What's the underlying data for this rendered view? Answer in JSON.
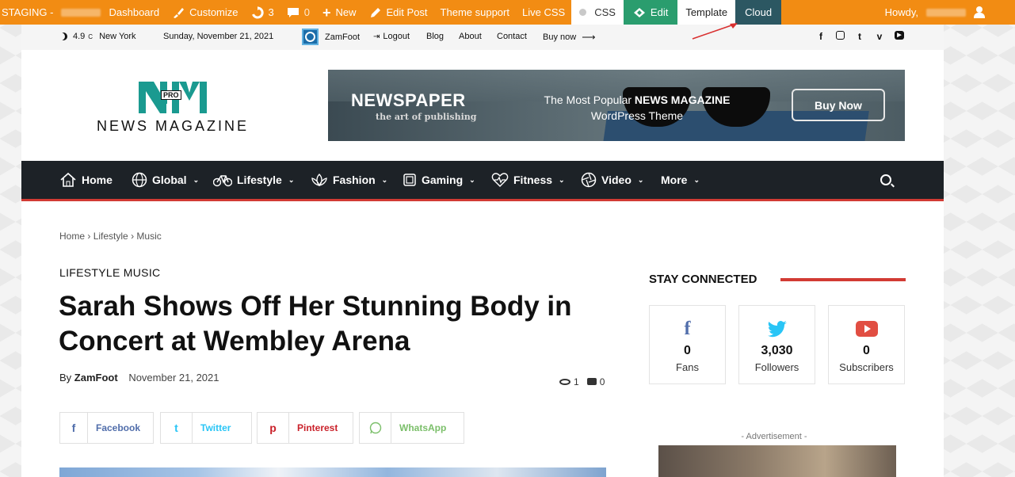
{
  "adminbar": {
    "site_prefix": "STAGING - ",
    "site_suffix": "Dashboard",
    "customize": "Customize",
    "updates_count": "3",
    "comments_count": "0",
    "new": "New",
    "edit_post": "Edit Post",
    "theme_support": "Theme support",
    "live_css": "Live CSS",
    "css": "CSS",
    "edit": "Edit",
    "template": "Template",
    "cloud": "Cloud",
    "howdy": "Howdy,"
  },
  "topbar": {
    "temp": "4.9",
    "temp_unit": "C",
    "city": "New York",
    "date": "Sunday, November 21, 2021",
    "user": "ZamFoot",
    "logout": "Logout",
    "links": [
      "Blog",
      "About",
      "Contact",
      "Buy now"
    ],
    "social_icons": [
      "facebook-icon",
      "instagram-icon",
      "twitter-icon",
      "vimeo-icon",
      "youtube-icon"
    ]
  },
  "header": {
    "logo_pro": "PRO",
    "logo_text": "NEWS MAGAZINE",
    "banner": {
      "brand": "NEWSPAPER",
      "tagline": "the art of publishing",
      "pitch_line1_pre": "The Most Popular ",
      "pitch_line1_bold": "NEWS MAGAZINE",
      "pitch_line2": "WordPress Theme",
      "cta": "Buy Now"
    }
  },
  "nav": {
    "items": [
      {
        "label": "Home",
        "icon": "home-icon"
      },
      {
        "label": "Global",
        "icon": "globe-icon"
      },
      {
        "label": "Lifestyle",
        "icon": "bicycle-icon"
      },
      {
        "label": "Fashion",
        "icon": "lotus-icon"
      },
      {
        "label": "Gaming",
        "icon": "gamepad-icon"
      },
      {
        "label": "Fitness",
        "icon": "heartbeat-icon"
      },
      {
        "label": "Video",
        "icon": "aperture-icon"
      },
      {
        "label": "More",
        "icon": ""
      }
    ]
  },
  "breadcrumb": [
    "Home",
    "Lifestyle",
    "Music"
  ],
  "article": {
    "categories": "LIFESTYLE MUSIC",
    "title": "Sarah Shows Off Her Stunning Body in Concert at Wembley Arena",
    "by": "By",
    "author": "ZamFoot",
    "date": "November 21, 2021",
    "views": "1",
    "comments": "0"
  },
  "share": [
    {
      "label": "Facebook",
      "color": "#516eab",
      "icon": "f"
    },
    {
      "label": "Twitter",
      "color": "#29c5f6",
      "icon": "t"
    },
    {
      "label": "Pinterest",
      "color": "#ca212a",
      "icon": "p"
    },
    {
      "label": "WhatsApp",
      "color": "#7bbf6a",
      "icon": "w"
    }
  ],
  "sidebar": {
    "stay_connected": "STAY CONNECTED",
    "social": [
      {
        "count": "0",
        "label": "Fans",
        "color": "#516eab"
      },
      {
        "count": "3,030",
        "label": "Followers",
        "color": "#29c5f6"
      },
      {
        "count": "0",
        "label": "Subscribers",
        "color": "#e14e42"
      }
    ],
    "ad_label": "- Advertisement -"
  },
  "colors": {
    "adminbar": "#f28c13",
    "accent_red": "#d23b34",
    "nav_bg": "#1d2227",
    "brand_teal": "#1a9a90"
  }
}
